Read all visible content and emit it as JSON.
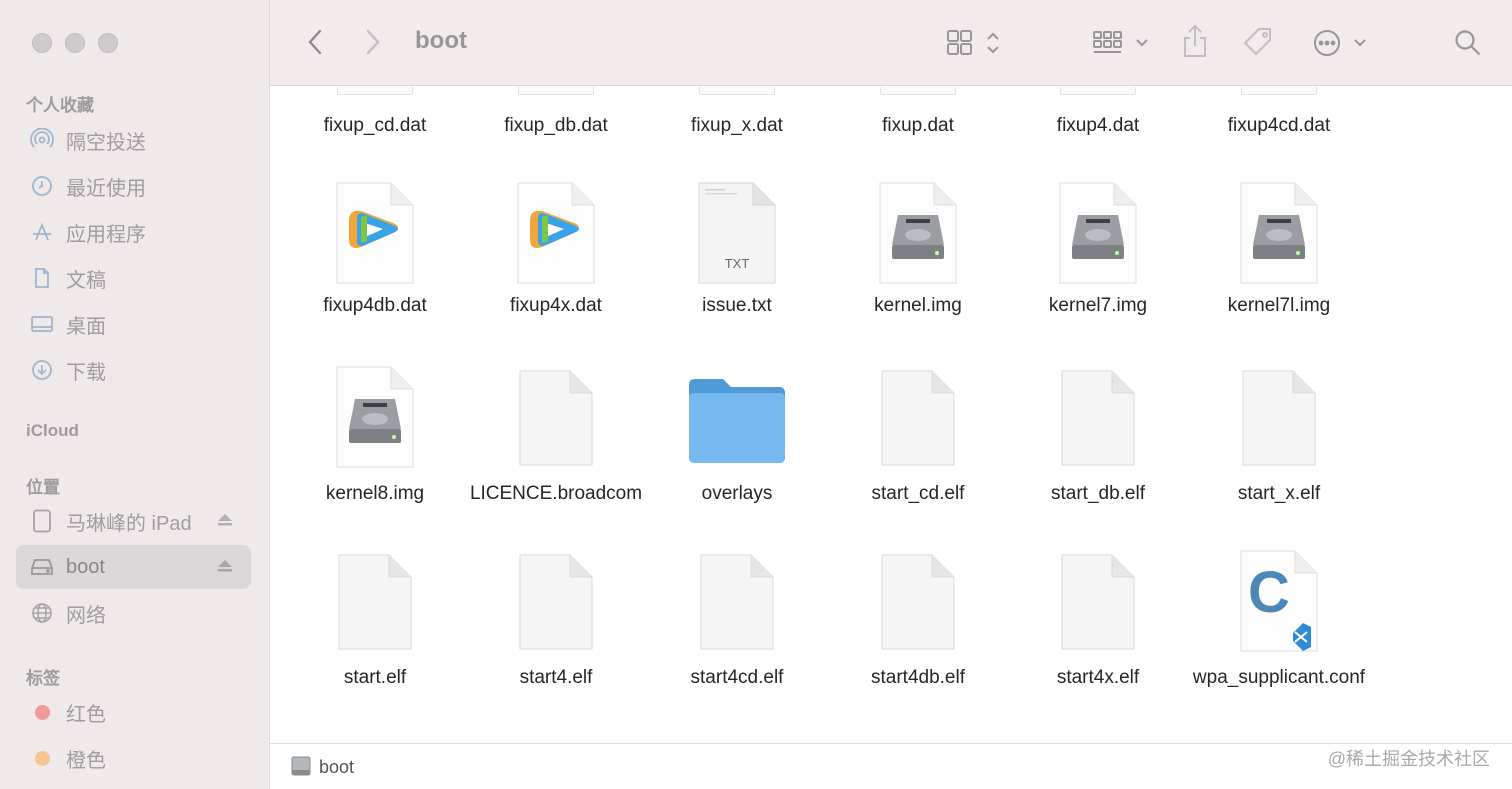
{
  "window": {
    "title": "boot",
    "traffic_lights": [
      "close",
      "minimize",
      "zoom"
    ]
  },
  "toolbar": {
    "back_icon": "chevron-left-icon",
    "forward_icon": "chevron-right-icon",
    "view_icon": "grid-view-icon",
    "group_icon": "group-view-icon",
    "share_icon": "share-icon",
    "tag_icon": "tag-icon",
    "more_icon": "ellipsis-icon",
    "search_icon": "search-icon"
  },
  "sidebar": {
    "favorites_title": "个人收藏",
    "favorites": [
      {
        "label": "隔空投送",
        "icon": "airdrop-icon"
      },
      {
        "label": "最近使用",
        "icon": "clock-icon"
      },
      {
        "label": "应用程序",
        "icon": "apps-icon"
      },
      {
        "label": "文稿",
        "icon": "document-icon"
      },
      {
        "label": "桌面",
        "icon": "desktop-icon"
      },
      {
        "label": "下载",
        "icon": "download-icon"
      }
    ],
    "icloud_title": "iCloud",
    "locations_title": "位置",
    "locations": [
      {
        "label": "马琳峰的 iPad",
        "icon": "ipad-icon",
        "eject": true
      },
      {
        "label": "boot",
        "icon": "disk-icon",
        "eject": true,
        "selected": true
      },
      {
        "label": "网络",
        "icon": "network-icon",
        "eject": false
      }
    ],
    "tags_title": "标签",
    "tags": [
      {
        "label": "红色",
        "color": "#f28b8b"
      },
      {
        "label": "橙色",
        "color": "#f5c27e"
      }
    ]
  },
  "files": {
    "row0": [
      "fixup_cd.dat",
      "fixup_db.dat",
      "fixup_x.dat",
      "fixup.dat",
      "fixup4.dat",
      "fixup4cd.dat"
    ],
    "row1": [
      {
        "name": "fixup4db.dat",
        "kind": "video"
      },
      {
        "name": "fixup4x.dat",
        "kind": "video"
      },
      {
        "name": "issue.txt",
        "kind": "txt",
        "badge": "TXT"
      },
      {
        "name": "kernel.img",
        "kind": "disk"
      },
      {
        "name": "kernel7.img",
        "kind": "disk"
      },
      {
        "name": "kernel7l.img",
        "kind": "disk"
      }
    ],
    "row2": [
      {
        "name": "kernel8.img",
        "kind": "disk"
      },
      {
        "name": "LICENCE.broadcom",
        "kind": "blank"
      },
      {
        "name": "overlays",
        "kind": "folder"
      },
      {
        "name": "start_cd.elf",
        "kind": "blank"
      },
      {
        "name": "start_db.elf",
        "kind": "blank"
      },
      {
        "name": "start_x.elf",
        "kind": "blank"
      }
    ],
    "row3": [
      {
        "name": "start.elf",
        "kind": "blank"
      },
      {
        "name": "start4.elf",
        "kind": "blank"
      },
      {
        "name": "start4cd.elf",
        "kind": "blank"
      },
      {
        "name": "start4db.elf",
        "kind": "blank"
      },
      {
        "name": "start4x.elf",
        "kind": "blank"
      },
      {
        "name": "wpa_supplicant.conf",
        "kind": "vscode-c",
        "badge": "C"
      }
    ]
  },
  "pathbar": {
    "label": "boot",
    "icon": "disk-icon"
  },
  "watermark": "@稀土掘金技术社区",
  "colors": {
    "folder": "#5aa9e6",
    "sidebar_bg": "#efe9ea",
    "toolbar_bg": "#f1ebeb"
  }
}
